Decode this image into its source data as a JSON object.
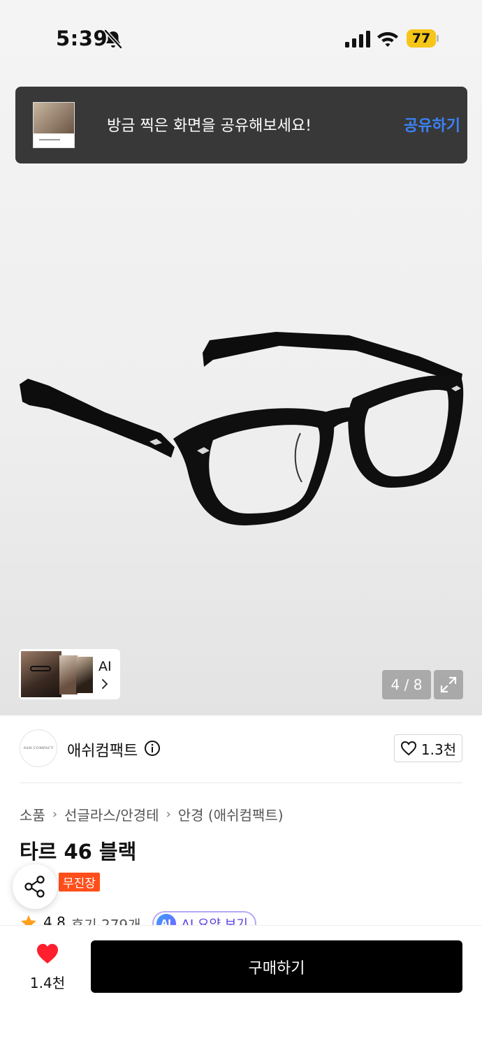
{
  "status_bar": {
    "time": "5:39",
    "battery": "77",
    "icons": [
      "bell-slash-icon",
      "signal-icon",
      "wifi-icon",
      "battery-icon"
    ],
    "battery_color": "#f5c518"
  },
  "share_toast": {
    "message": "방금 찍은 화면을 공유해보세요!",
    "action_label": "공유하기",
    "action_color": "#3b82f6"
  },
  "gallery": {
    "counter": "4 / 8",
    "ai_chip_label": "AI",
    "icons": [
      "expand-icon",
      "chevron-right-icon"
    ]
  },
  "brand": {
    "name": "애쉬컴팩트",
    "logo_text": "ASH COMPACT",
    "like_count": "1.3천",
    "icons": [
      "info-icon",
      "heart-outline-icon"
    ]
  },
  "breadcrumb": [
    "소품",
    "선글라스/안경테",
    "안경 (애쉬컴팩트)"
  ],
  "product": {
    "title": "타르 46 블랙",
    "badge": "무진장",
    "badge_color": "#ff4e1a",
    "rating": "4.8",
    "reviews": "후기 279개",
    "ai_summary_label": "AI 요약 보기"
  },
  "bottom_bar": {
    "wish_count": "1.4천",
    "buy_label": "구매하기",
    "heart_color": "#ff1f2d"
  }
}
